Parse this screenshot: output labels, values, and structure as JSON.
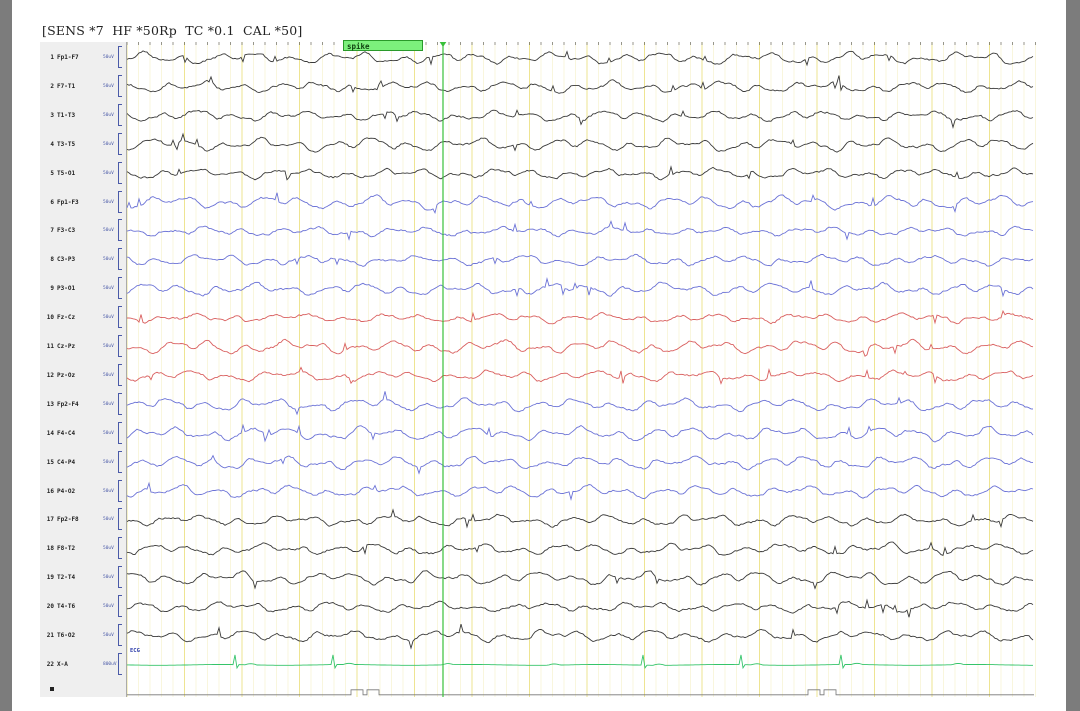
{
  "header": {
    "text": "[SENS *7  HF *50Rp  TC *0.1  CAL *50]"
  },
  "event_marker": {
    "label": "spike"
  },
  "ecg_tag": "ECG",
  "colors": {
    "black_trace": "#3a3a3a",
    "blue_trace": "#6b72d6",
    "red_trace": "#d96060",
    "ecg_trace": "#35c46a",
    "grid_major": "#ece28a",
    "grid_minor": "#f5f1c6",
    "cursor": "#38c038"
  },
  "channels": [
    {
      "num": "1",
      "name": "Fp1-F7",
      "sens": "50uV",
      "color": "black"
    },
    {
      "num": "2",
      "name": "F7-T1",
      "sens": "50uV",
      "color": "black"
    },
    {
      "num": "3",
      "name": "T1-T3",
      "sens": "50uV",
      "color": "black"
    },
    {
      "num": "4",
      "name": "T3-T5",
      "sens": "50uV",
      "color": "black"
    },
    {
      "num": "5",
      "name": "T5-O1",
      "sens": "50uV",
      "color": "black"
    },
    {
      "num": "6",
      "name": "Fp1-F3",
      "sens": "50uV",
      "color": "blue"
    },
    {
      "num": "7",
      "name": "F3-C3",
      "sens": "50uV",
      "color": "blue"
    },
    {
      "num": "8",
      "name": "C3-P3",
      "sens": "50uV",
      "color": "blue"
    },
    {
      "num": "9",
      "name": "P3-O1",
      "sens": "50uV",
      "color": "blue"
    },
    {
      "num": "10",
      "name": "Fz-Cz",
      "sens": "50uV",
      "color": "red"
    },
    {
      "num": "11",
      "name": "Cz-Pz",
      "sens": "50uV",
      "color": "red"
    },
    {
      "num": "12",
      "name": "Pz-Oz",
      "sens": "50uV",
      "color": "red"
    },
    {
      "num": "13",
      "name": "Fp2-F4",
      "sens": "50uV",
      "color": "blue"
    },
    {
      "num": "14",
      "name": "F4-C4",
      "sens": "50uV",
      "color": "blue"
    },
    {
      "num": "15",
      "name": "C4-P4",
      "sens": "50uV",
      "color": "blue"
    },
    {
      "num": "16",
      "name": "P4-O2",
      "sens": "50uV",
      "color": "blue"
    },
    {
      "num": "17",
      "name": "Fp2-F8",
      "sens": "50uV",
      "color": "black"
    },
    {
      "num": "18",
      "name": "F8-T2",
      "sens": "50uV",
      "color": "black"
    },
    {
      "num": "19",
      "name": "T2-T4",
      "sens": "50uV",
      "color": "black"
    },
    {
      "num": "20",
      "name": "T4-T6",
      "sens": "50uV",
      "color": "black"
    },
    {
      "num": "21",
      "name": "T6-O2",
      "sens": "50uV",
      "color": "black"
    },
    {
      "num": "22",
      "name": "X-A",
      "sens": "800uV",
      "color": "ecg"
    }
  ]
}
